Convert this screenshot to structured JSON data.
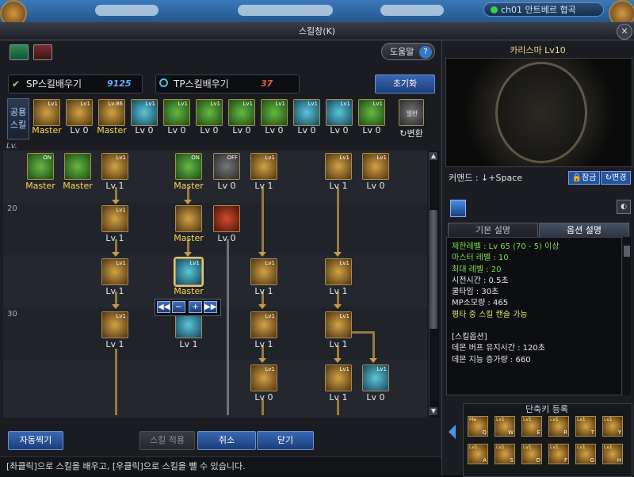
{
  "topbar": {
    "channel": "ch01 안트베르 협곡"
  },
  "window": {
    "title": "스킬창(K)",
    "close": "✕"
  },
  "header": {
    "help_label": "도움말",
    "help_q": "?",
    "sp_label": "SP스킬배우기",
    "sp_value": "9125",
    "tp_label": "TP스킬배우기",
    "tp_value": "37",
    "reset_label": "초기화",
    "common_label_1": "공용",
    "common_label_2": "스킬",
    "convert_label": "↻변환",
    "convert_sub": "일반",
    "lv_header": "Lv."
  },
  "common_skills": [
    {
      "level": "Master",
      "color": "y",
      "tag": "Lv1"
    },
    {
      "level": "Lv 0",
      "color": "y",
      "tag": "Lv1"
    },
    {
      "level": "Master",
      "color": "y",
      "tag": "Lv.86"
    },
    {
      "level": "Lv 0",
      "color": "c",
      "tag": "Lv1"
    },
    {
      "level": "Lv 0",
      "color": "g",
      "tag": "Lv1"
    },
    {
      "level": "Lv 0",
      "color": "g",
      "tag": "Lv1"
    },
    {
      "level": "Lv 0",
      "color": "g",
      "tag": "Lv1"
    },
    {
      "level": "Lv 0",
      "color": "g",
      "tag": "Lv1"
    },
    {
      "level": "Lv 0",
      "color": "c",
      "tag": "Lv1"
    },
    {
      "level": "Lv 0",
      "color": "c",
      "tag": "Lv1"
    },
    {
      "level": "Lv 0",
      "color": "g",
      "tag": "Lv1"
    }
  ],
  "tree": {
    "row_labels": [
      "20",
      "30"
    ],
    "skills": [
      {
        "level": "Master",
        "color": "g",
        "tag": "ON",
        "master": true
      },
      {
        "level": "Master",
        "color": "g",
        "tag": "",
        "master": true
      },
      {
        "level": "Lv 1",
        "color": "y",
        "tag": "Lv1",
        "master": false
      },
      {
        "level": "Master",
        "color": "g",
        "tag": "ON",
        "master": true
      },
      {
        "level": "Lv 0",
        "color": "d",
        "tag": "OFF",
        "master": false
      },
      {
        "level": "Lv 1",
        "color": "y",
        "tag": "Lv1",
        "master": false
      },
      {
        "level": "Lv 1",
        "color": "y",
        "tag": "Lv1",
        "master": false
      },
      {
        "level": "Lv 0",
        "color": "y",
        "tag": "Lv1",
        "master": false
      },
      {
        "level": "Lv 1",
        "color": "y",
        "tag": "Lv1",
        "master": false
      },
      {
        "level": "Master",
        "color": "y",
        "tag": "",
        "master": true
      },
      {
        "level": "Lv 0",
        "color": "r",
        "tag": "",
        "master": false
      },
      {
        "level": "Lv 1",
        "color": "y",
        "tag": "Lv1",
        "master": false
      },
      {
        "level": "Master",
        "color": "c",
        "tag": "Lv1",
        "master": true
      },
      {
        "level": "Lv 1",
        "color": "y",
        "tag": "Lv1",
        "master": false
      },
      {
        "level": "Lv 1",
        "color": "y",
        "tag": "Lv1",
        "master": false
      },
      {
        "level": "Lv 1",
        "color": "y",
        "tag": "Lv1",
        "master": false
      },
      {
        "level": "Lv 1",
        "color": "c",
        "tag": "",
        "master": false
      },
      {
        "level": "Lv 1",
        "color": "y",
        "tag": "Lv1",
        "master": false
      },
      {
        "level": "Lv 1",
        "color": "y",
        "tag": "Lv1",
        "master": false
      },
      {
        "level": "Lv 0",
        "color": "y",
        "tag": "Lv1",
        "master": false
      },
      {
        "level": "Lv 1",
        "color": "y",
        "tag": "Lv1",
        "master": false
      },
      {
        "level": "Lv 0",
        "color": "c",
        "tag": "Lv1",
        "master": false
      }
    ]
  },
  "stepper": {
    "first": "◀◀",
    "minus": "−",
    "plus": "+",
    "last": "▶▶"
  },
  "bottom": {
    "auto_label": "자동찍기",
    "apply_label": "스킬 적용",
    "cancel_label": "취소",
    "close_label": "닫기",
    "hint": "[좌클릭]으로 스킬을 배우고, [우클릭]으로 스킬을 뺄 수 있습니다."
  },
  "detail": {
    "name": "카리스마 Lv10",
    "command": "커맨드 : ↓+Space",
    "lock_label": "🔒잠금",
    "change_label": "↻변경",
    "tab_basic": "기본 설명",
    "tab_option": "옵션 설명",
    "lines": [
      {
        "text": "제한레벨 : Lv 65 (70 - 5) 이상",
        "cls": "green"
      },
      {
        "text": "마스터 레벨 : 10",
        "cls": "green"
      },
      {
        "text": "최대 레벨 : 20",
        "cls": "green"
      },
      {
        "text": "시전시간 : 0.5초",
        "cls": "white"
      },
      {
        "text": "쿨타임 : 30초",
        "cls": "white"
      },
      {
        "text": "MP소모량 : 465",
        "cls": "white"
      },
      {
        "text": "평타 중 스킬 캔슬 가능",
        "cls": "yellowish"
      },
      {
        "text": "",
        "cls": "white"
      },
      {
        "text": "[스킬옵션]",
        "cls": "white"
      },
      {
        "text": "데몬 버프 유지시간 : 120초",
        "cls": "white"
      },
      {
        "text": "데몬 지능 증가량 : 660",
        "cls": "white"
      }
    ]
  },
  "quickslot": {
    "title": "단축키 등록",
    "slots": [
      {
        "key": "Q",
        "tag": "Ma"
      },
      {
        "key": "W",
        "tag": "Lv1"
      },
      {
        "key": "E",
        "tag": "Lv1"
      },
      {
        "key": "R",
        "tag": "Lv1"
      },
      {
        "key": "T",
        "tag": "Lv1"
      },
      {
        "key": "Y",
        "tag": "Lv1"
      },
      {
        "key": "A",
        "tag": "Lv1"
      },
      {
        "key": "S",
        "tag": "Lv1"
      },
      {
        "key": "D",
        "tag": "Lv1"
      },
      {
        "key": "F",
        "tag": "Lv1"
      },
      {
        "key": "G",
        "tag": "Lv1"
      },
      {
        "key": "H",
        "tag": "Lv1"
      }
    ]
  }
}
